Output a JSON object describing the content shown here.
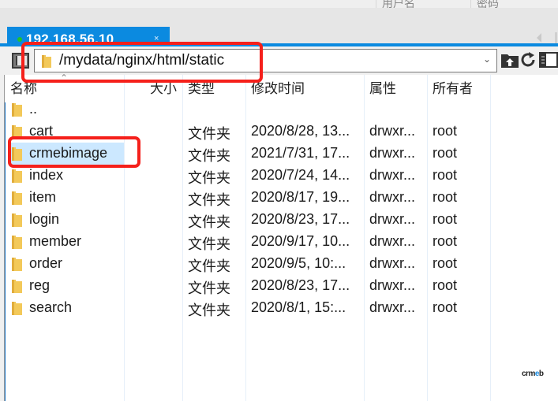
{
  "top_headers": {
    "username": "用户名",
    "password": "密码"
  },
  "tab": {
    "title": "192.168.56.10",
    "close": "×",
    "status_color": "#22c22a"
  },
  "toolbar": {
    "path": "/mydata/nginx/html/static",
    "dropdown_icon": "chevron-down-icon",
    "actions": [
      "upload-folder-icon",
      "refresh-icon",
      "toggle-panel-icon"
    ]
  },
  "columns": {
    "name": "名称",
    "size": "大小",
    "type": "类型",
    "modified": "修改时间",
    "attributes": "属性",
    "owner": "所有者"
  },
  "parent_entry": "..",
  "files": [
    {
      "name": "cart",
      "size": "",
      "type": "文件夹",
      "modified": "2020/8/28, 13...",
      "attributes": "drwxr...",
      "owner": "root",
      "selected": false
    },
    {
      "name": "crmebimage",
      "size": "",
      "type": "文件夹",
      "modified": "2021/7/31, 17...",
      "attributes": "drwxr...",
      "owner": "root",
      "selected": true
    },
    {
      "name": "index",
      "size": "",
      "type": "文件夹",
      "modified": "2020/7/24, 14...",
      "attributes": "drwxr...",
      "owner": "root",
      "selected": false
    },
    {
      "name": "item",
      "size": "",
      "type": "文件夹",
      "modified": "2020/8/17, 19...",
      "attributes": "drwxr...",
      "owner": "root",
      "selected": false
    },
    {
      "name": "login",
      "size": "",
      "type": "文件夹",
      "modified": "2020/8/23, 17...",
      "attributes": "drwxr...",
      "owner": "root",
      "selected": false
    },
    {
      "name": "member",
      "size": "",
      "type": "文件夹",
      "modified": "2020/9/17, 10...",
      "attributes": "drwxr...",
      "owner": "root",
      "selected": false
    },
    {
      "name": "order",
      "size": "",
      "type": "文件夹",
      "modified": "2020/9/5, 10:...",
      "attributes": "drwxr...",
      "owner": "root",
      "selected": false
    },
    {
      "name": "reg",
      "size": "",
      "type": "文件夹",
      "modified": "2020/8/23, 17...",
      "attributes": "drwxr...",
      "owner": "root",
      "selected": false
    },
    {
      "name": "search",
      "size": "",
      "type": "文件夹",
      "modified": "2020/8/1, 15:...",
      "attributes": "drwxr...",
      "owner": "root",
      "selected": false
    }
  ],
  "watermark": {
    "prefix": "crm",
    "accent": "e",
    "suffix": "b"
  },
  "colors": {
    "accent": "#0b8ae0",
    "annotation_red": "#f5201b",
    "selection": "#cce8ff"
  }
}
